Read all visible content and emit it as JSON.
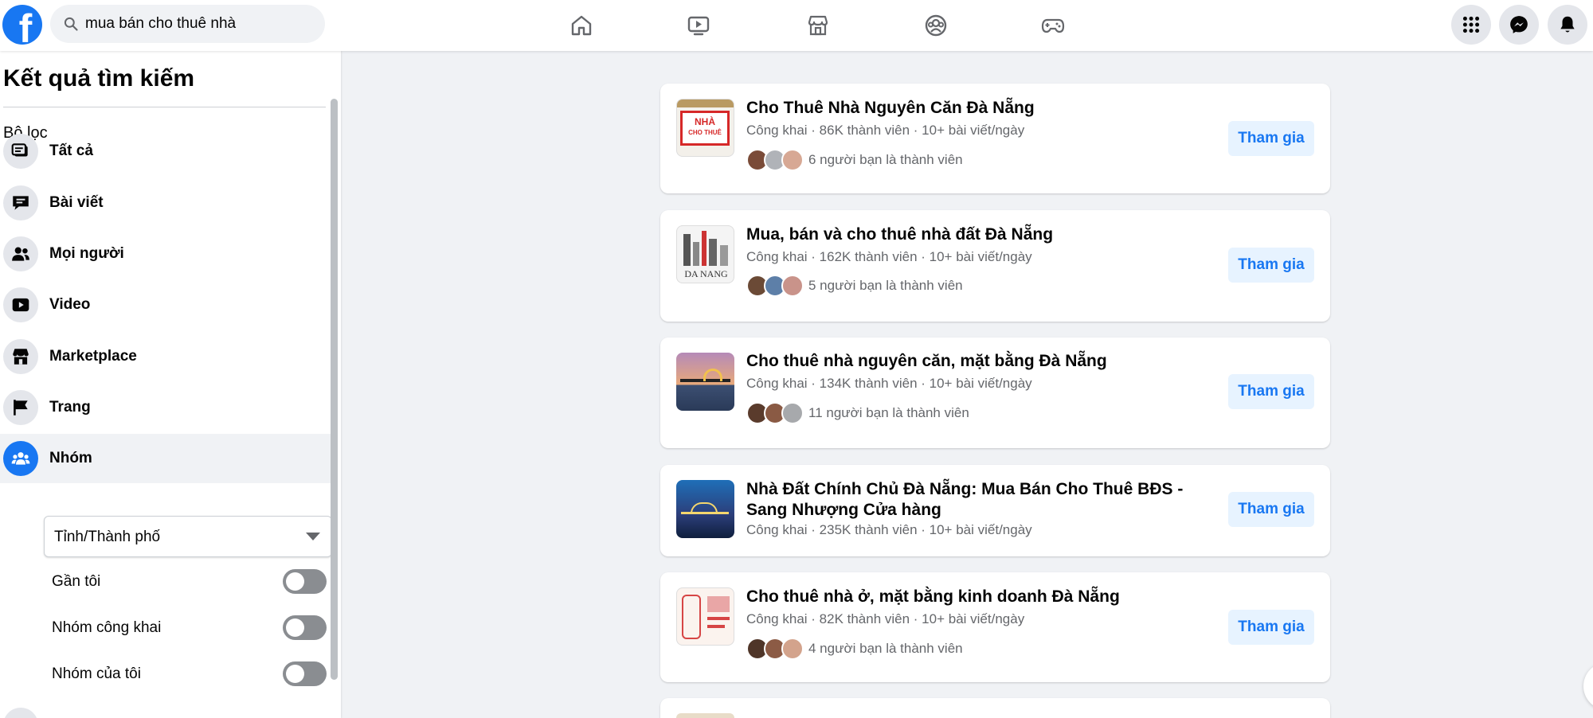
{
  "search": {
    "query": "mua bán cho thuê nhà"
  },
  "nav": {
    "icons": [
      "home-icon",
      "watch-icon",
      "marketplace-icon",
      "groups-icon",
      "gaming-icon"
    ]
  },
  "sidebar": {
    "title": "Kết quả tìm kiếm",
    "filter_label": "Bộ lọc",
    "items": [
      {
        "label": "Tất cả",
        "icon": "all-results-icon"
      },
      {
        "label": "Bài viết",
        "icon": "posts-icon"
      },
      {
        "label": "Mọi người",
        "icon": "people-icon"
      },
      {
        "label": "Video",
        "icon": "video-icon"
      },
      {
        "label": "Marketplace",
        "icon": "marketplace-icon"
      },
      {
        "label": "Trang",
        "icon": "pages-flag-icon"
      },
      {
        "label": "Nhóm",
        "icon": "groups-icon"
      }
    ],
    "active_item": "Nhóm",
    "location_dropdown": "Tỉnh/Thành phố",
    "toggles": [
      {
        "label": "Gần tôi",
        "on": false
      },
      {
        "label": "Nhóm công khai",
        "on": false
      },
      {
        "label": "Nhóm của tôi",
        "on": false
      }
    ]
  },
  "results": [
    {
      "title": "Cho Thuê Nhà Nguyên Căn Đà Nẵng",
      "meta": "Công khai · 86K thành viên · 10+ bài viết/ngày",
      "friends": "6 người bạn là thành viên",
      "join_label": "Tham gia",
      "thumb_text_1": "NHÀ",
      "thumb_text_2": "CHO THUÊ"
    },
    {
      "title": "Mua, bán và cho thuê nhà đất Đà Nẵng",
      "meta": "Công khai · 162K thành viên · 10+ bài viết/ngày",
      "friends": "5 người bạn là thành viên",
      "join_label": "Tham gia",
      "thumb_text_1": "DA NANG"
    },
    {
      "title": "Cho thuê nhà nguyên căn, mặt bằng Đà Nẵng",
      "meta": "Công khai · 134K thành viên · 10+ bài viết/ngày",
      "friends": "11 người bạn là thành viên",
      "join_label": "Tham gia"
    },
    {
      "title": "Nhà Đất Chính Chủ Đà Nẵng: Mua Bán Cho Thuê BĐS - Sang Nhượng Cửa hàng",
      "meta": "Công khai · 235K thành viên · 10+ bài viết/ngày",
      "join_label": "Tham gia"
    },
    {
      "title": "Cho thuê nhà ở, mặt bằng kinh doanh Đà Nẵng",
      "meta": "Công khai · 82K thành viên · 10+ bài viết/ngày",
      "friends": "4 người bạn là thành viên",
      "join_label": "Tham gia"
    }
  ]
}
